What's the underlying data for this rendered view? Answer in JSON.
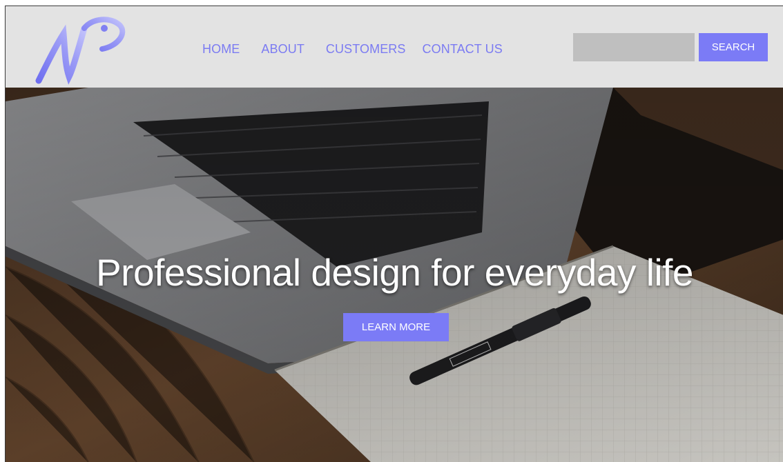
{
  "brand": {
    "logo_text": "NP",
    "accent_color": "#7b7bf6",
    "header_bg": "#e3e3e3"
  },
  "nav": {
    "items": [
      {
        "label": "HOME"
      },
      {
        "label": "ABOUT"
      },
      {
        "label": "CUSTOMERS"
      },
      {
        "label": "CONTACT US"
      }
    ]
  },
  "search": {
    "value": "",
    "placeholder": "",
    "button_label": "SEARCH"
  },
  "hero": {
    "title": "Professional design for everyday life",
    "cta_label": "LEARN MORE",
    "background": "photo of laptop, notebook and pen on wooden desk"
  }
}
